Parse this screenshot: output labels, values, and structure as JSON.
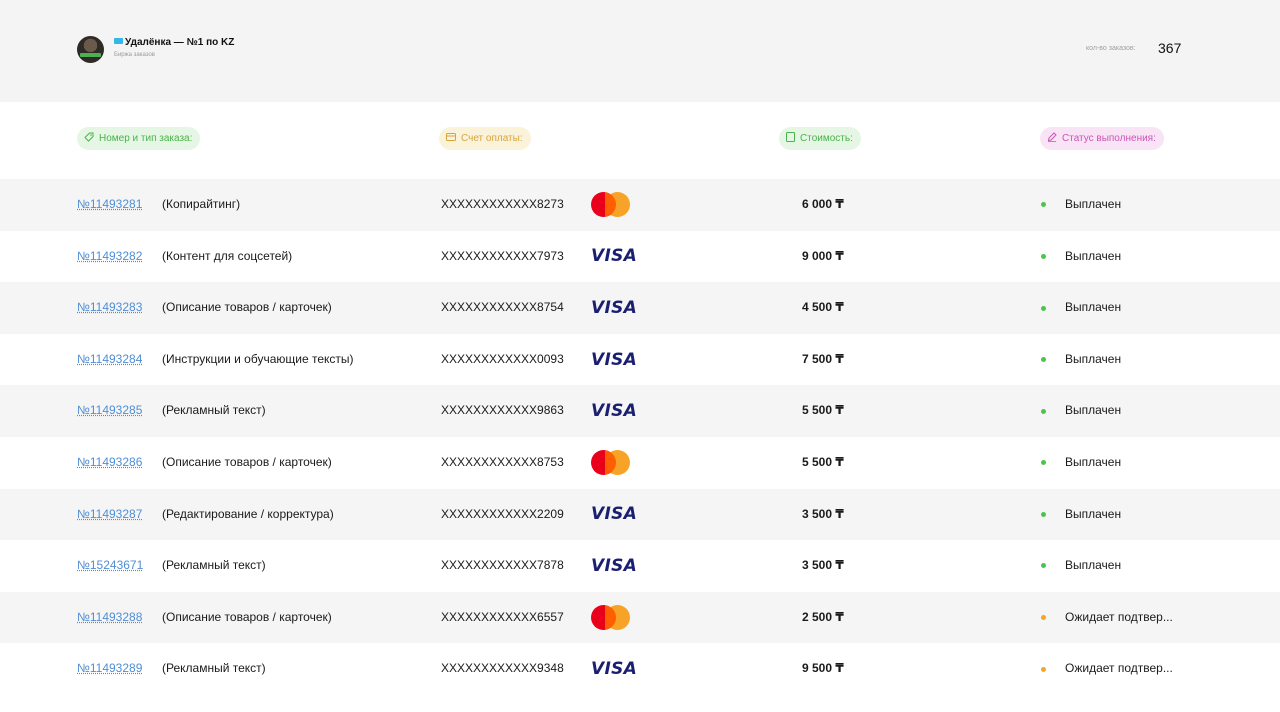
{
  "header": {
    "title": "Удалёнка — №1 по KZ",
    "subtitle": "Биржа заказов",
    "count_label": "кол-во заказов:",
    "count_value": "367"
  },
  "columns": {
    "order": "Номер и тип заказа:",
    "account": "Счет оплаты:",
    "price": "Стоимость:",
    "status": "Статус выполнения:"
  },
  "colors": {
    "paid": "#4cc44c",
    "pending": "#f5a623",
    "link": "#4f8ed6"
  },
  "orders": [
    {
      "number": "№11493281",
      "type": "(Копирайтинг)",
      "account": "XXXXXXXXXXXX8273",
      "card": "mastercard",
      "price": "6 000 ₸",
      "status": "Выплачен",
      "state": "paid"
    },
    {
      "number": "№11493282",
      "type": "(Контент для соцсетей)",
      "account": "XXXXXXXXXXXX7973",
      "card": "visa",
      "price": "9 000 ₸",
      "status": "Выплачен",
      "state": "paid"
    },
    {
      "number": "№11493283",
      "type": "(Описание товаров / карточек)",
      "account": "XXXXXXXXXXXX8754",
      "card": "visa",
      "price": "4 500 ₸",
      "status": "Выплачен",
      "state": "paid"
    },
    {
      "number": "№11493284",
      "type": "(Инструкции и обучающие тексты)",
      "account": "XXXXXXXXXXXX0093",
      "card": "visa",
      "price": "7 500 ₸",
      "status": "Выплачен",
      "state": "paid"
    },
    {
      "number": "№11493285",
      "type": "(Рекламный текст)",
      "account": "XXXXXXXXXXXX9863",
      "card": "visa",
      "price": "5 500 ₸",
      "status": "Выплачен",
      "state": "paid"
    },
    {
      "number": "№11493286",
      "type": "(Описание товаров / карточек)",
      "account": "XXXXXXXXXXXX8753",
      "card": "mastercard",
      "price": "5 500 ₸",
      "status": "Выплачен",
      "state": "paid"
    },
    {
      "number": "№11493287",
      "type": "(Редактирование / корректура)",
      "account": "XXXXXXXXXXXX2209",
      "card": "visa",
      "price": "3 500 ₸",
      "status": "Выплачен",
      "state": "paid"
    },
    {
      "number": "№15243671",
      "type": "(Рекламный текст)",
      "account": "XXXXXXXXXXXX7878",
      "card": "visa",
      "price": "3 500 ₸",
      "status": "Выплачен",
      "state": "paid"
    },
    {
      "number": "№11493288",
      "type": "(Описание товаров / карточек)",
      "account": "XXXXXXXXXXXX6557",
      "card": "mastercard",
      "price": "2 500 ₸",
      "status": "Ожидает подтвер...",
      "state": "pending"
    },
    {
      "number": "№11493289",
      "type": "(Рекламный текст)",
      "account": "XXXXXXXXXXXX9348",
      "card": "visa",
      "price": "9 500 ₸",
      "status": "Ожидает подтвер...",
      "state": "pending"
    }
  ]
}
